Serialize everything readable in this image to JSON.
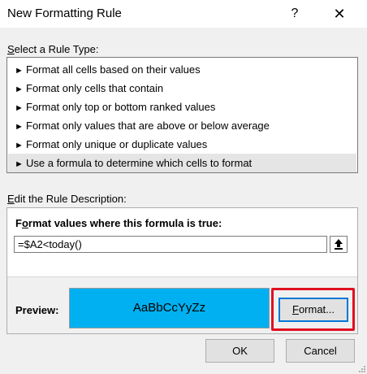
{
  "window": {
    "title": "New Formatting Rule",
    "help_label": "?",
    "close_label": "✕"
  },
  "rule_type": {
    "label_prefix": "",
    "label_accel": "S",
    "label_rest": "elect a Rule Type:",
    "items": [
      {
        "label": "Format all cells based on their values",
        "selected": false
      },
      {
        "label": "Format only cells that contain",
        "selected": false
      },
      {
        "label": "Format only top or bottom ranked values",
        "selected": false
      },
      {
        "label": "Format only values that are above or below average",
        "selected": false
      },
      {
        "label": "Format only unique or duplicate values",
        "selected": false
      },
      {
        "label": "Use a formula to determine which cells to format",
        "selected": true
      }
    ],
    "bullet": "►"
  },
  "description": {
    "label_accel": "E",
    "label_rest": "dit the Rule Description:",
    "formula_label_accel": "o",
    "formula_label_pre": "F",
    "formula_label_rest": "rmat values where this formula is true:",
    "formula_value": "=$A2<today()",
    "preview_label": "Preview:",
    "preview_text": "AaBbCcYyZz",
    "preview_fill_color": "#00b0f0",
    "format_button_accel": "F",
    "format_button_rest": "ormat..."
  },
  "footer": {
    "ok_label": "OK",
    "cancel_label": "Cancel"
  },
  "colors": {
    "highlight_border": "#e01020",
    "focus_blue": "#0078d7"
  }
}
